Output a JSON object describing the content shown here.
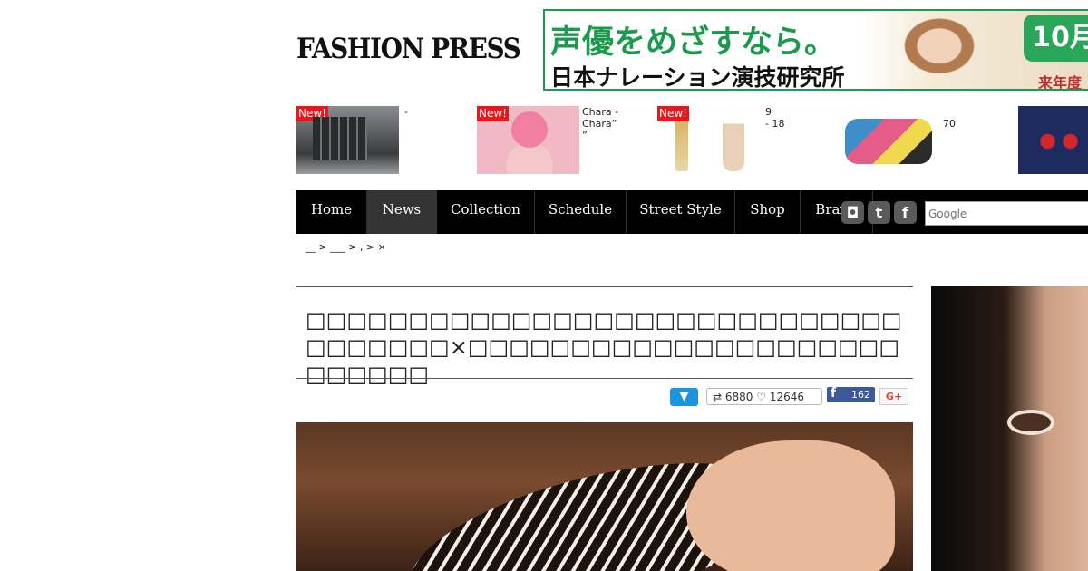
{
  "header": {
    "logo": "FASHION PRESS",
    "ad": {
      "line1": "声優をめざすなら。",
      "line2": "日本ナレーション演技研究所",
      "month": "10月",
      "year": "来年度"
    }
  },
  "thumbs": [
    {
      "new": "New!",
      "caption": "-"
    },
    {
      "new": "New!",
      "caption": "Chara -\nChara”\n”"
    },
    {
      "new": "New!",
      "caption": "9\n- 18"
    },
    {
      "new": "",
      "caption": "70"
    },
    {
      "new": "",
      "caption": ""
    }
  ],
  "nav": {
    "items": [
      "Home",
      "News",
      "Collection",
      "Schedule",
      "Street Style",
      "Shop",
      "Brand"
    ],
    "active": "News"
  },
  "social": {
    "instagram_icon": "instagram-icon",
    "tumblr_icon": "tumblr-icon",
    "facebook_icon": "facebook-icon"
  },
  "search": {
    "placeholder": "Google"
  },
  "breadcrumb": "__ > ___ > , > ×",
  "article": {
    "title": "□□□□□□□□□□□□□□□□□□□□□□□□□□□□□□□□□□□□×□□□□□□□□□□□□□□□□□□□□□□□□□□□"
  },
  "share": {
    "twitter_label": "▼",
    "retweets": "6880",
    "likes": "12646",
    "facebook_label": "f",
    "facebook_count": "162",
    "gplus_label": "G+"
  },
  "colors": {
    "nav_bg": "#000000",
    "new_badge": "#e8171b",
    "twitter": "#1b95e0",
    "facebook": "#3b5998",
    "ad_green": "#1b9a4e"
  }
}
